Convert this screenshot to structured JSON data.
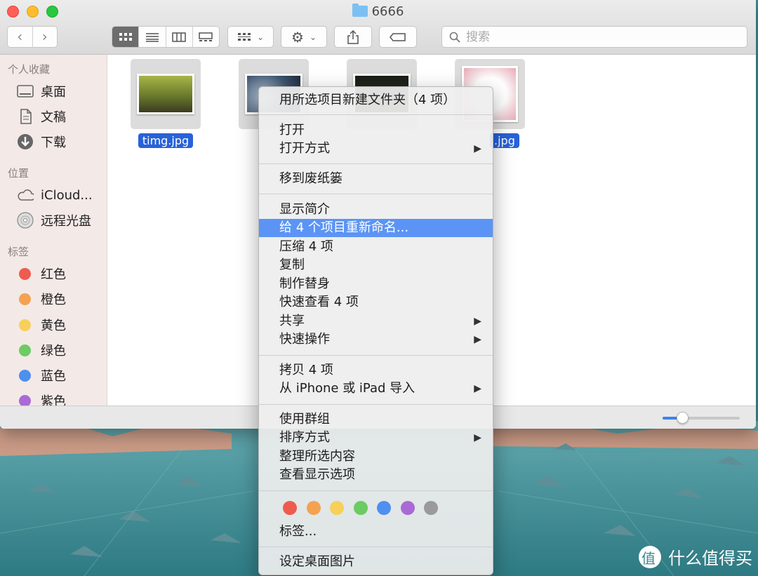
{
  "window": {
    "title": "6666"
  },
  "toolbar": {
    "back_icon": "chevron-left-icon",
    "forward_icon": "chevron-right-icon",
    "search_placeholder": "搜索"
  },
  "sidebar": {
    "favorites_heading": "个人收藏",
    "favorites": [
      {
        "label": "桌面",
        "icon": "desktop-icon"
      },
      {
        "label": "文稿",
        "icon": "document-icon"
      },
      {
        "label": "下载",
        "icon": "download-icon"
      }
    ],
    "locations_heading": "位置",
    "locations": [
      {
        "label": "iCloud...",
        "icon": "cloud-icon"
      },
      {
        "label": "远程光盘",
        "icon": "disc-icon"
      }
    ],
    "tags_heading": "标签",
    "tags": [
      {
        "label": "红色",
        "color": "#ee5b4f"
      },
      {
        "label": "橙色",
        "color": "#f4a250"
      },
      {
        "label": "黄色",
        "color": "#f6d05a"
      },
      {
        "label": "绿色",
        "color": "#6ccb62"
      },
      {
        "label": "蓝色",
        "color": "#4e8ff0"
      },
      {
        "label": "紫色",
        "color": "#a96ad6"
      }
    ]
  },
  "files": [
    {
      "name": "timg.jpg"
    },
    {
      "name": ""
    },
    {
      "name": ""
    },
    {
      "name": ".jpg"
    }
  ],
  "status": {
    "icon_size_fraction": 0.25
  },
  "context_menu": {
    "new_folder": "用所选项目新建文件夹（4 项）",
    "open": "打开",
    "open_with": "打开方式",
    "move_to_trash": "移到废纸篓",
    "get_info": "显示简介",
    "rename": "给 4 个项目重新命名...",
    "compress": "压缩 4 项",
    "duplicate": "复制",
    "make_alias": "制作替身",
    "quick_look": "快速查看 4 项",
    "share": "共享",
    "quick_actions": "快速操作",
    "copy": "拷贝 4 项",
    "import_from": "从 iPhone 或 iPad 导入",
    "use_groups": "使用群组",
    "sort_by": "排序方式",
    "clean_up": "整理所选内容",
    "view_options": "查看显示选项",
    "tag_colors": [
      "#ee5b4f",
      "#f4a250",
      "#f6d05a",
      "#6ccb62",
      "#4e8ff0",
      "#a96ad6",
      "#9a9a9a"
    ],
    "tags": "标签...",
    "set_desktop": "设定桌面图片",
    "submenu_arrow": "▶"
  },
  "watermark": {
    "text": "什么值得买"
  }
}
